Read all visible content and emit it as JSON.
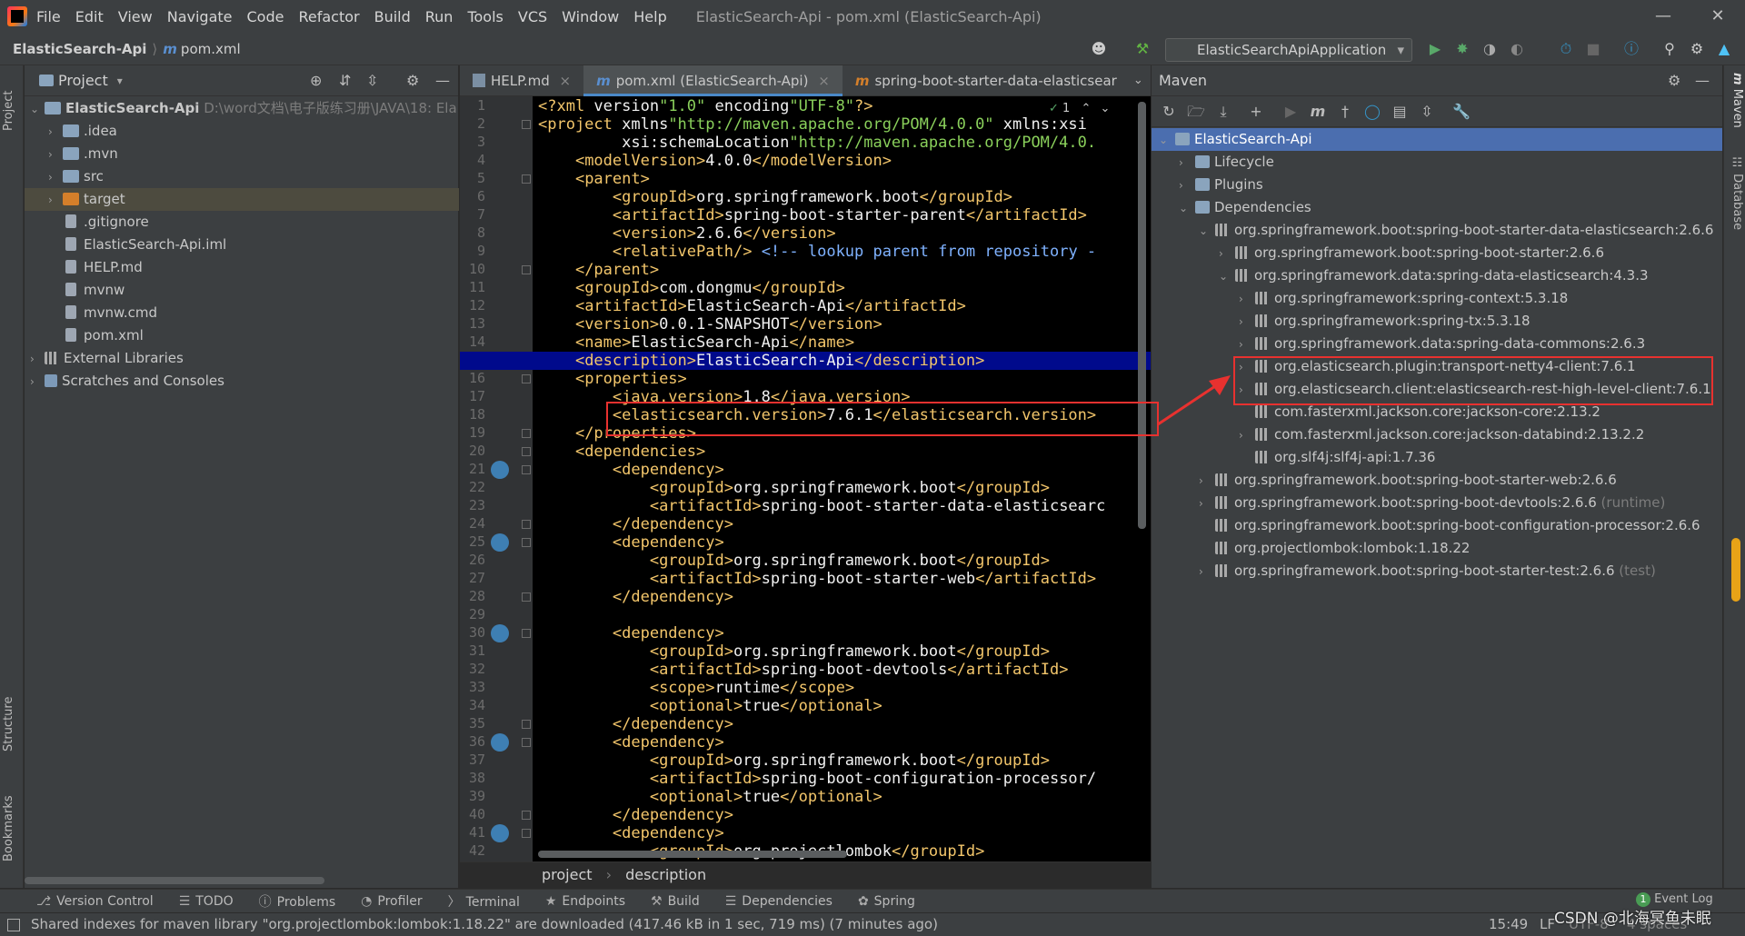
{
  "window": {
    "title": "ElasticSearch-Api - pom.xml (ElasticSearch-Api)",
    "menu": [
      "File",
      "Edit",
      "View",
      "Navigate",
      "Code",
      "Refactor",
      "Build",
      "Run",
      "Tools",
      "VCS",
      "Window",
      "Help"
    ]
  },
  "navbar": {
    "project": "ElasticSearch-Api",
    "file": "pom.xml",
    "run_config": "ElasticSearchApiApplication"
  },
  "left_stripe": {
    "project_tab": "Project",
    "structure_tab": "Structure",
    "bookmarks_tab": "Bookmarks"
  },
  "right_stripe": {
    "maven_tab": "Maven",
    "database_tab": "Database"
  },
  "project_panel": {
    "title": "Project",
    "root": {
      "name": "ElasticSearch-Api",
      "path": "D:\\word文档\\电子版练习册\\JAVA\\18: Ela"
    },
    "items": [
      {
        "label": ".idea",
        "kind": "folder"
      },
      {
        "label": ".mvn",
        "kind": "folder"
      },
      {
        "label": "src",
        "kind": "folder"
      },
      {
        "label": "target",
        "kind": "folder-orange"
      },
      {
        "label": ".gitignore",
        "kind": "file"
      },
      {
        "label": "ElasticSearch-Api.iml",
        "kind": "file"
      },
      {
        "label": "HELP.md",
        "kind": "file"
      },
      {
        "label": "mvnw",
        "kind": "file"
      },
      {
        "label": "mvnw.cmd",
        "kind": "file"
      },
      {
        "label": "pom.xml",
        "kind": "file"
      }
    ],
    "external_libraries": "External Libraries",
    "scratches": "Scratches and Consoles"
  },
  "editor": {
    "tabs": [
      "HELP.md",
      "pom.xml (ElasticSearch-Api)",
      "spring-boot-starter-data-elasticsear"
    ],
    "problems_count": "1",
    "current_line": 15,
    "breadcrumb": [
      "project",
      "description"
    ],
    "lines": [
      "<?xml version=\"1.0\" encoding=\"UTF-8\"?>",
      "<project xmlns=\"http://maven.apache.org/POM/4.0.0\" xmlns:xsi",
      "         xsi:schemaLocation=\"http://maven.apache.org/POM/4.0.",
      "    <modelVersion>4.0.0</modelVersion>",
      "    <parent>",
      "        <groupId>org.springframework.boot</groupId>",
      "        <artifactId>spring-boot-starter-parent</artifactId>",
      "        <version>2.6.6</version>",
      "        <relativePath/> <!-- lookup parent from repository -",
      "    </parent>",
      "    <groupId>com.dongmu</groupId>",
      "    <artifactId>ElasticSearch-Api</artifactId>",
      "    <version>0.0.1-SNAPSHOT</version>",
      "    <name>ElasticSearch-Api</name>",
      "    <description>ElasticSearch-Api</description>",
      "    <properties>",
      "        <java.version>1.8</java.version>",
      "        <elasticsearch.version>7.6.1</elasticsearch.version>",
      "    </properties>",
      "    <dependencies>",
      "        <dependency>",
      "            <groupId>org.springframework.boot</groupId>",
      "            <artifactId>spring-boot-starter-data-elasticsearc",
      "        </dependency>",
      "        <dependency>",
      "            <groupId>org.springframework.boot</groupId>",
      "            <artifactId>spring-boot-starter-web</artifactId>",
      "        </dependency>",
      "",
      "        <dependency>",
      "            <groupId>org.springframework.boot</groupId>",
      "            <artifactId>spring-boot-devtools</artifactId>",
      "            <scope>runtime</scope>",
      "            <optional>true</optional>",
      "        </dependency>",
      "        <dependency>",
      "            <groupId>org.springframework.boot</groupId>",
      "            <artifactId>spring-boot-configuration-processor</",
      "            <optional>true</optional>",
      "        </dependency>",
      "        <dependency>",
      "            <groupId>org.projectlombok</groupId>"
    ]
  },
  "maven_panel": {
    "title": "Maven",
    "rows": [
      {
        "depth": 0,
        "arrow": "v",
        "label": "ElasticSearch-Api",
        "suffix": "",
        "selected": true,
        "icon": "module"
      },
      {
        "depth": 1,
        "arrow": ">",
        "label": "Lifecycle",
        "suffix": "",
        "icon": "folder"
      },
      {
        "depth": 1,
        "arrow": ">",
        "label": "Plugins",
        "suffix": "",
        "icon": "folder"
      },
      {
        "depth": 1,
        "arrow": "v",
        "label": "Dependencies",
        "suffix": "",
        "icon": "folder"
      },
      {
        "depth": 2,
        "arrow": "v",
        "label": "org.springframework.boot:spring-boot-starter-data-elasticsearch:2.6.6",
        "suffix": "",
        "icon": "lib"
      },
      {
        "depth": 3,
        "arrow": ">",
        "label": "org.springframework.boot:spring-boot-starter:2.6.6",
        "suffix": "",
        "icon": "lib"
      },
      {
        "depth": 3,
        "arrow": "v",
        "label": "org.springframework.data:spring-data-elasticsearch:4.3.3",
        "suffix": "",
        "icon": "lib"
      },
      {
        "depth": 4,
        "arrow": ">",
        "label": "org.springframework:spring-context:5.3.18",
        "suffix": "",
        "icon": "lib"
      },
      {
        "depth": 4,
        "arrow": ">",
        "label": "org.springframework:spring-tx:5.3.18",
        "suffix": "",
        "icon": "lib"
      },
      {
        "depth": 4,
        "arrow": ">",
        "label": "org.springframework.data:spring-data-commons:2.6.3",
        "suffix": "",
        "icon": "lib"
      },
      {
        "depth": 4,
        "arrow": ">",
        "label": "org.elasticsearch.plugin:transport-netty4-client:7.6.1",
        "suffix": "",
        "icon": "lib"
      },
      {
        "depth": 4,
        "arrow": ">",
        "label": "org.elasticsearch.client:elasticsearch-rest-high-level-client:7.6.1",
        "suffix": "",
        "icon": "lib"
      },
      {
        "depth": 4,
        "arrow": "",
        "label": "com.fasterxml.jackson.core:jackson-core:2.13.2",
        "suffix": "",
        "icon": "lib"
      },
      {
        "depth": 4,
        "arrow": ">",
        "label": "com.fasterxml.jackson.core:jackson-databind:2.13.2.2",
        "suffix": "",
        "icon": "lib"
      },
      {
        "depth": 4,
        "arrow": "",
        "label": "org.slf4j:slf4j-api:1.7.36",
        "suffix": "",
        "icon": "lib"
      },
      {
        "depth": 2,
        "arrow": ">",
        "label": "org.springframework.boot:spring-boot-starter-web:2.6.6",
        "suffix": "",
        "icon": "lib"
      },
      {
        "depth": 2,
        "arrow": ">",
        "label": "org.springframework.boot:spring-boot-devtools:2.6.6",
        "suffix": " (runtime)",
        "icon": "lib"
      },
      {
        "depth": 2,
        "arrow": "",
        "label": "org.springframework.boot:spring-boot-configuration-processor:2.6.6",
        "suffix": "",
        "icon": "lib"
      },
      {
        "depth": 2,
        "arrow": "",
        "label": "org.projectlombok:lombok:1.18.22",
        "suffix": "",
        "icon": "lib"
      },
      {
        "depth": 2,
        "arrow": ">",
        "label": "org.springframework.boot:spring-boot-starter-test:2.6.6",
        "suffix": " (test)",
        "icon": "lib"
      }
    ]
  },
  "bottom_tools": [
    "Version Control",
    "TODO",
    "Problems",
    "Profiler",
    "Terminal",
    "Endpoints",
    "Build",
    "Dependencies",
    "Spring"
  ],
  "event_log": {
    "label": "Event Log",
    "count": "1"
  },
  "status": {
    "message": "Shared indexes for maven library \"org.projectlombok:lombok:1.18.22\" are downloaded (417.46 kB in 1 sec, 719 ms) (7 minutes ago)",
    "time": "15:49",
    "line_sep": "LF",
    "encoding": "UTF-8",
    "indent": "4 spaces"
  },
  "watermark": "CSDN @北海冥鱼未眠",
  "colors": {
    "accent": "#4a88c7",
    "annotation": "#e8312f",
    "selection": "#4b6eaf"
  }
}
